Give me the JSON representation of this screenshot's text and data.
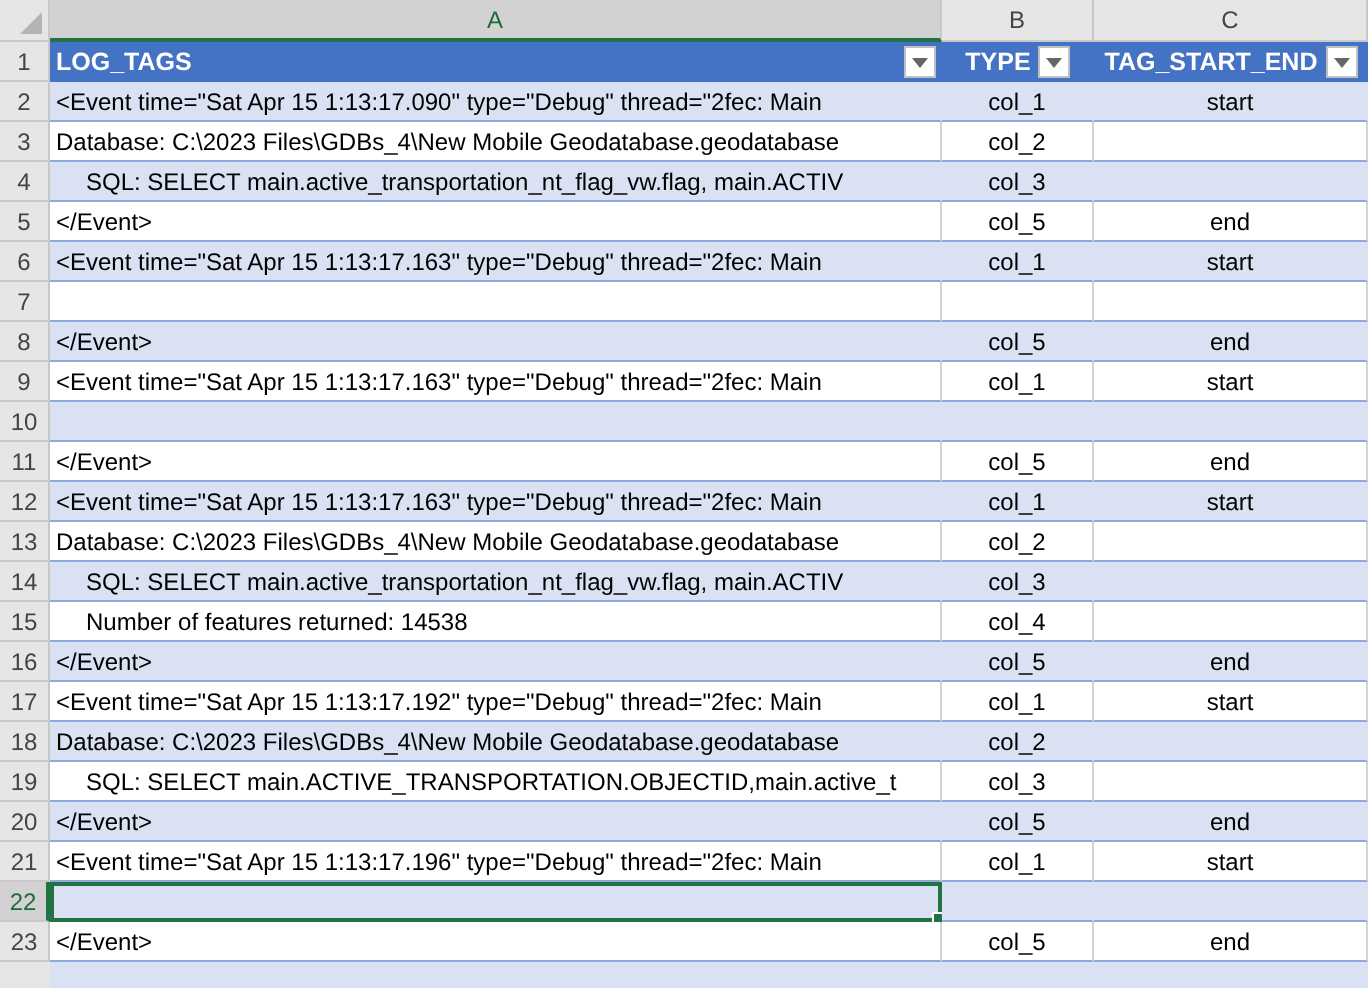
{
  "columns": [
    {
      "letter": "A",
      "selected": true
    },
    {
      "letter": "B",
      "selected": false
    },
    {
      "letter": "C",
      "selected": false
    }
  ],
  "header": {
    "number": "1",
    "cells": [
      "LOG_TAGS",
      "TYPE",
      "TAG_START_END"
    ]
  },
  "rows": [
    {
      "number": "2",
      "indent": false,
      "selected": false,
      "cells": [
        "<Event time=\"Sat Apr 15 1:13:17.090\" type=\"Debug\" thread=\"2fec: Main",
        "col_1",
        "start"
      ]
    },
    {
      "number": "3",
      "indent": false,
      "selected": false,
      "cells": [
        "Database: C:\\2023 Files\\GDBs_4\\New Mobile Geodatabase.geodatabase",
        "col_2",
        ""
      ]
    },
    {
      "number": "4",
      "indent": true,
      "selected": false,
      "cells": [
        "SQL: SELECT main.active_transportation_nt_flag_vw.flag, main.ACTIV",
        "col_3",
        ""
      ]
    },
    {
      "number": "5",
      "indent": false,
      "selected": false,
      "cells": [
        "</Event>",
        "col_5",
        "end"
      ]
    },
    {
      "number": "6",
      "indent": false,
      "selected": false,
      "cells": [
        "<Event time=\"Sat Apr 15 1:13:17.163\" type=\"Debug\" thread=\"2fec: Main",
        "col_1",
        "start"
      ]
    },
    {
      "number": "7",
      "indent": false,
      "selected": false,
      "cells": [
        "",
        "",
        ""
      ]
    },
    {
      "number": "8",
      "indent": false,
      "selected": false,
      "cells": [
        "</Event>",
        "col_5",
        "end"
      ]
    },
    {
      "number": "9",
      "indent": false,
      "selected": false,
      "cells": [
        "<Event time=\"Sat Apr 15 1:13:17.163\" type=\"Debug\" thread=\"2fec: Main",
        "col_1",
        "start"
      ]
    },
    {
      "number": "10",
      "indent": false,
      "selected": false,
      "cells": [
        "",
        "",
        ""
      ]
    },
    {
      "number": "11",
      "indent": false,
      "selected": false,
      "cells": [
        "</Event>",
        "col_5",
        "end"
      ]
    },
    {
      "number": "12",
      "indent": false,
      "selected": false,
      "cells": [
        "<Event time=\"Sat Apr 15 1:13:17.163\" type=\"Debug\" thread=\"2fec: Main",
        "col_1",
        "start"
      ]
    },
    {
      "number": "13",
      "indent": false,
      "selected": false,
      "cells": [
        "Database: C:\\2023 Files\\GDBs_4\\New Mobile Geodatabase.geodatabase",
        "col_2",
        ""
      ]
    },
    {
      "number": "14",
      "indent": true,
      "selected": false,
      "cells": [
        "SQL: SELECT main.active_transportation_nt_flag_vw.flag, main.ACTIV",
        "col_3",
        ""
      ]
    },
    {
      "number": "15",
      "indent": true,
      "selected": false,
      "cells": [
        "Number of features returned: 14538",
        "col_4",
        ""
      ]
    },
    {
      "number": "16",
      "indent": false,
      "selected": false,
      "cells": [
        "</Event>",
        "col_5",
        "end"
      ]
    },
    {
      "number": "17",
      "indent": false,
      "selected": false,
      "cells": [
        "<Event time=\"Sat Apr 15 1:13:17.192\" type=\"Debug\" thread=\"2fec: Main",
        "col_1",
        "start"
      ]
    },
    {
      "number": "18",
      "indent": false,
      "selected": false,
      "cells": [
        "Database: C:\\2023 Files\\GDBs_4\\New Mobile Geodatabase.geodatabase",
        "col_2",
        ""
      ]
    },
    {
      "number": "19",
      "indent": true,
      "selected": false,
      "cells": [
        "SQL: SELECT main.ACTIVE_TRANSPORTATION.OBJECTID,main.active_t",
        "col_3",
        ""
      ]
    },
    {
      "number": "20",
      "indent": false,
      "selected": false,
      "cells": [
        "</Event>",
        "col_5",
        "end"
      ]
    },
    {
      "number": "21",
      "indent": false,
      "selected": false,
      "cells": [
        "<Event time=\"Sat Apr 15 1:13:17.196\" type=\"Debug\" thread=\"2fec: Main",
        "col_1",
        "start"
      ]
    },
    {
      "number": "22",
      "indent": false,
      "selected": true,
      "cells": [
        "",
        "",
        ""
      ]
    },
    {
      "number": "23",
      "indent": false,
      "selected": false,
      "cells": [
        "</Event>",
        "col_5",
        "end"
      ]
    }
  ]
}
